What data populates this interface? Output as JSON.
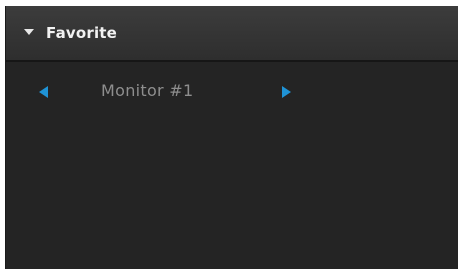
{
  "panel": {
    "title": "Favorite",
    "toggle_icon": "triangle-down-icon",
    "expanded": true
  },
  "monitor": {
    "label": "Monitor #1",
    "prev_icon": "arrow-left-icon",
    "next_icon": "arrow-right-icon"
  },
  "colors": {
    "panel_background": "#242424",
    "header_background": "#363636",
    "header_text": "#f2f2f2",
    "label_text": "#8e8e8e",
    "accent": "#1f93d6"
  }
}
